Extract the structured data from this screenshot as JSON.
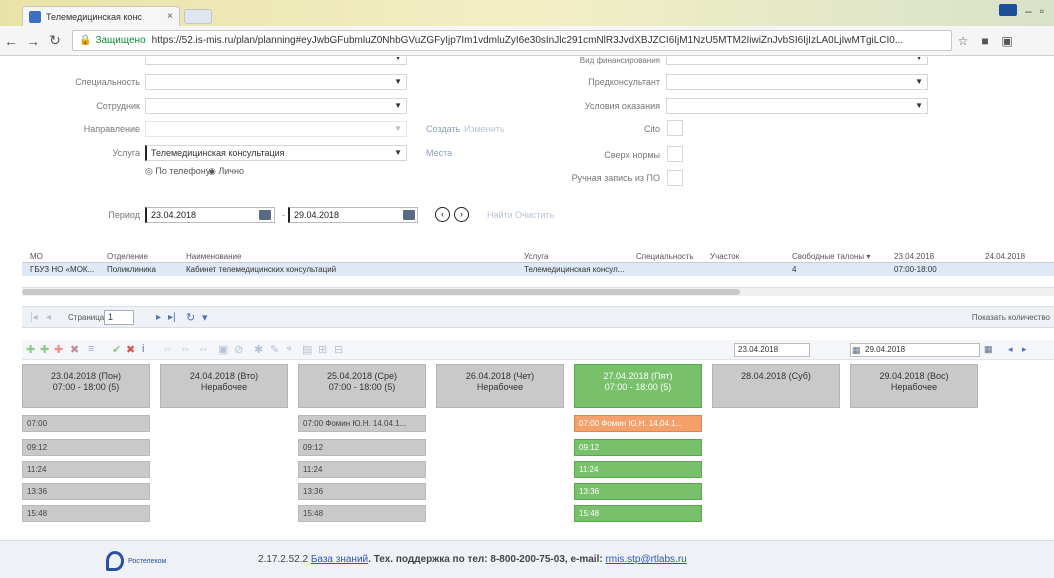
{
  "browser": {
    "tab_title": "Телемедицинская конс",
    "tab_close": "×",
    "security_label": "Защищено",
    "url": "https://52.is-mis.ru/plan/planning#eyJwbGFubmluZ0NhbGVuZGFyIjp7Im1vdmluZyI6e30sInJlc291cmNlR3JvdXBJZCI6IjM1NzU5MTM2IiwiZnJvbSI6IjIzLA0LjIwMTgiLCI0..."
  },
  "form": {
    "row0_right": "Вид финансирования",
    "specialty_label": "Специальность",
    "employee_label": "Сотрудник",
    "direction_label": "Направление",
    "service_label": "Услуга",
    "service_value": "Телемедицинская консультация",
    "create_link": "Создать",
    "change_link": "Изменить",
    "places_link": "Места",
    "preconsultant_label": "Предконсультант",
    "conditions_label": "Условия оказания",
    "cito_label": "Cito",
    "over_norm_label": "Сверх нормы",
    "manual_label": "Ручная запись из ПО",
    "radio_phone": "По телефону",
    "radio_personal": "Лично",
    "period_label": "Период",
    "date_from": "23.04.2018",
    "date_sep": "-",
    "date_to": "29.04.2018",
    "find_link": "Найти",
    "clear_link": "Очистить"
  },
  "grid": {
    "headers": [
      "МО",
      "Отделение",
      "Наименование",
      "Услуга",
      "Специальность",
      "Участок",
      "Свободные талоны ▾",
      "23.04.2018",
      "24.04.2018"
    ],
    "row": [
      "ГБУЗ НО «МОК...",
      "Поликлиника",
      "Кабинет телемедицинских консультаций",
      "Телемедицинская консул...",
      "",
      "",
      "4",
      "07:00-18:00",
      ""
    ]
  },
  "pager": {
    "page_label": "Страница",
    "page_value": "1",
    "right_label": "Показать количество"
  },
  "toolbar": {
    "date_from": "23.04.2018",
    "date_to": "29.04.2018"
  },
  "days": [
    {
      "date": "23.04.2018 (Пон)",
      "sub": "07:00 - 18:00 (5)"
    },
    {
      "date": "24.04.2018 (Вто)",
      "sub": "Нерабочее"
    },
    {
      "date": "25.04.2018 (Сре)",
      "sub": "07:00 - 18:00 (5)"
    },
    {
      "date": "26.04.2018 (Чет)",
      "sub": "Нерабочее"
    },
    {
      "date": "27.04.2018 (Пят)",
      "sub": "07:00 - 18:00 (5)"
    },
    {
      "date": "28.04.2018 (Суб)",
      "sub": ""
    },
    {
      "date": "29.04.2018 (Вос)",
      "sub": "Нерабочее"
    }
  ],
  "slots_mon": [
    "07:00",
    "09:12",
    "11:24",
    "13:36",
    "15:48"
  ],
  "slots_wed": [
    "07:00 Фомин Ю.Н. 14.04.1...",
    "09:12",
    "11:24",
    "13:36",
    "15:48"
  ],
  "slots_fri": [
    "07:00 Фомин Ю.Н. 14.04.1...",
    "09:12",
    "11:24",
    "13:36",
    "15:48"
  ],
  "footer": {
    "logo_text": "Ростелеком",
    "version": "2.17.2.52.2",
    "kb_link": "База знаний",
    "support": ". Тех. поддержка по тел: 8-800-200-75-03, e-mail:",
    "email": "rmis.stp@rtlabs.ru"
  }
}
